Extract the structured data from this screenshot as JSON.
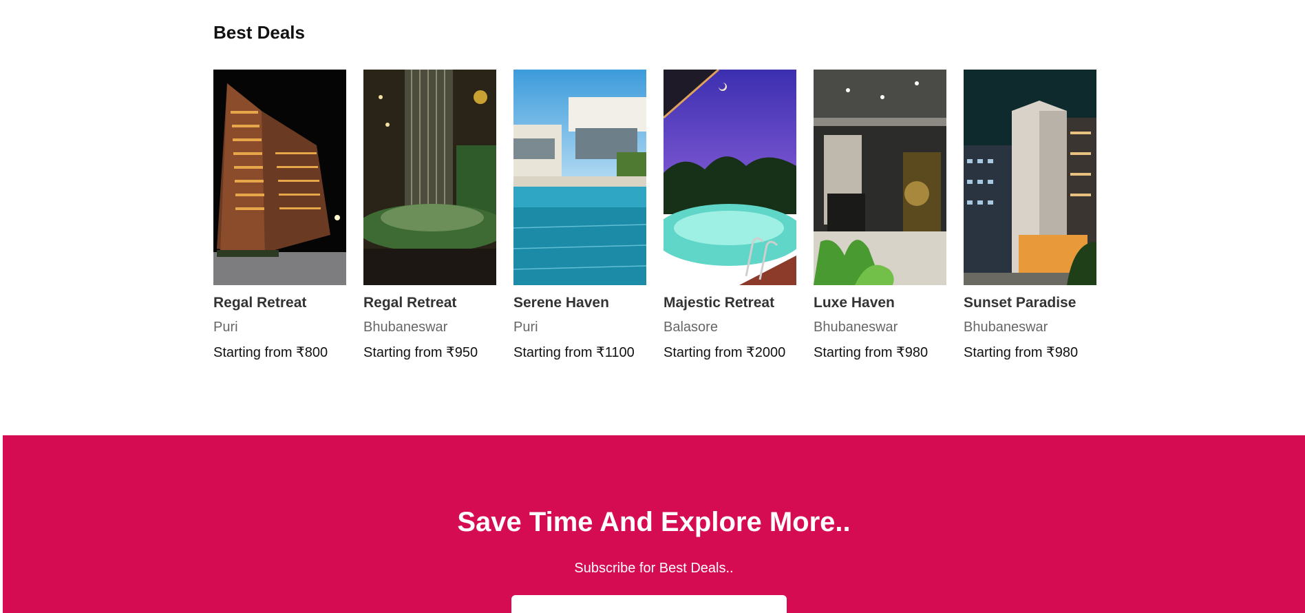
{
  "deals": {
    "title": "Best Deals",
    "cards": [
      {
        "name": "Regal Retreat",
        "city": "Puri",
        "price": "Starting from ₹800"
      },
      {
        "name": "Regal Retreat",
        "city": "Bhubaneswar",
        "price": "Starting from ₹950"
      },
      {
        "name": "Serene Haven",
        "city": "Puri",
        "price": "Starting from ₹1100"
      },
      {
        "name": "Majestic Retreat",
        "city": "Balasore",
        "price": "Starting from ₹2000"
      },
      {
        "name": "Luxe Haven",
        "city": "Bhubaneswar",
        "price": "Starting from ₹980"
      },
      {
        "name": "Sunset Paradise",
        "city": "Bhubaneswar",
        "price": "Starting from ₹980"
      }
    ]
  },
  "subscribe": {
    "title": "Save Time And Explore More..",
    "subtitle": "Subscribe for Best Deals..",
    "bg_color": "#d50c52"
  }
}
